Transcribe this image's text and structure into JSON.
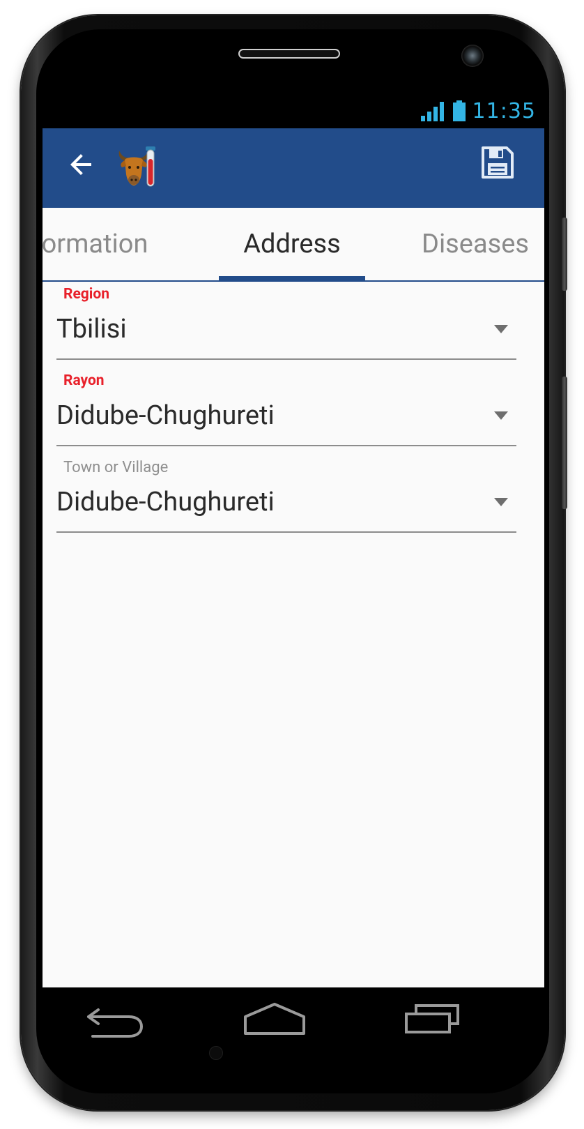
{
  "status_bar": {
    "time": "11:35",
    "signal_icon": "signal-icon",
    "battery_icon": "battery-icon"
  },
  "toolbar": {
    "back_icon": "arrow-left-icon",
    "app_icon": "bull-test-tube-icon",
    "save_icon": "floppy-disk-icon",
    "background_color": "#224c8a"
  },
  "tabs": [
    {
      "label": "ormation",
      "active": false
    },
    {
      "label": "Address",
      "active": true
    },
    {
      "label": "Diseases",
      "active": false
    }
  ],
  "form": {
    "region": {
      "label": "Region",
      "value": "Tbilisi",
      "required": true
    },
    "rayon": {
      "label": "Rayon",
      "value": "Didube-Chughureti",
      "required": true
    },
    "town": {
      "label": "Town or Village",
      "value": "Didube-Chughureti",
      "required": false
    }
  },
  "nav_bar": {
    "back_icon": "back-nav-icon",
    "home_icon": "home-nav-icon",
    "recents_icon": "recents-nav-icon"
  },
  "colors": {
    "accent": "#224c8a",
    "required_label": "#e8202a",
    "status": "#33b5e5"
  }
}
